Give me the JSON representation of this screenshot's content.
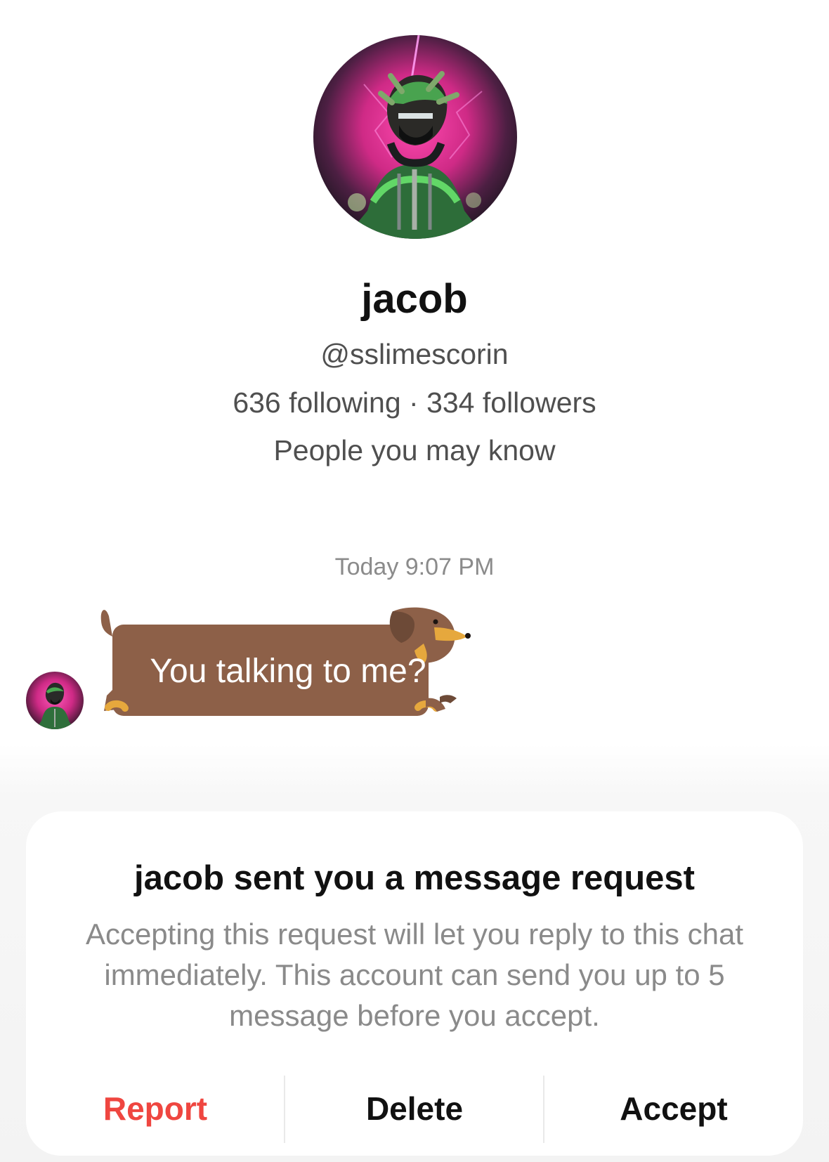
{
  "profile": {
    "display_name": "jacob",
    "username": "@sslimescorin",
    "stats": "636 following · 334 followers",
    "relationship_hint": "People you may know",
    "avatar_icon": "profile-avatar-artwork"
  },
  "conversation": {
    "timestamp": "Today 9:07 PM",
    "sender_avatar_icon": "sender-avatar-artwork",
    "sticker": {
      "icon": "dachshund-sticker",
      "text": "You talking to me?"
    }
  },
  "message_request": {
    "title": "jacob sent you a message request",
    "description": "Accepting this request will let you reply to this chat immediately. This account can send you up to 5 message before you accept.",
    "actions": {
      "report": "Report",
      "delete": "Delete",
      "accept": "Accept"
    }
  },
  "colors": {
    "report": "#ef4640",
    "sticker_brown": "#8d6048",
    "sticker_tan": "#e6a83d"
  }
}
